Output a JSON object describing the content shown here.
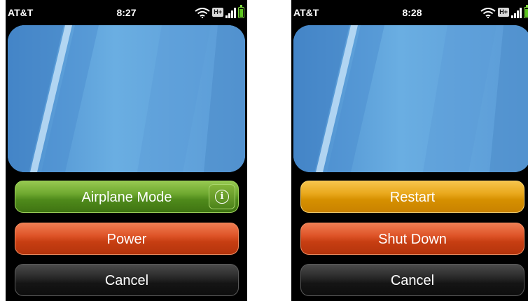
{
  "screens": [
    {
      "status": {
        "carrier": "AT&T",
        "time": "8:27",
        "network": "H+",
        "signal_bars": 4,
        "battery_level": 0.85
      },
      "buttons": [
        {
          "label": "Airplane Mode",
          "style": "green",
          "info_icon": "info-icon"
        },
        {
          "label": "Power",
          "style": "red"
        },
        {
          "label": "Cancel",
          "style": "black"
        }
      ]
    },
    {
      "status": {
        "carrier": "AT&T",
        "time": "8:28",
        "network": "H+",
        "signal_bars": 4,
        "battery_level": 0.85
      },
      "buttons": [
        {
          "label": "Restart",
          "style": "orange"
        },
        {
          "label": "Shut Down",
          "style": "red"
        },
        {
          "label": "Cancel",
          "style": "black"
        }
      ]
    }
  ],
  "colors": {
    "green": "#6fa930",
    "red": "#de5428",
    "orange": "#e9a81c",
    "black": "#1a1a1a",
    "wallpaper": "#5fa3d9",
    "battery": "#5cc51e"
  },
  "icons": [
    "wifi-icon",
    "signal-icon",
    "battery-icon",
    "info-icon"
  ]
}
